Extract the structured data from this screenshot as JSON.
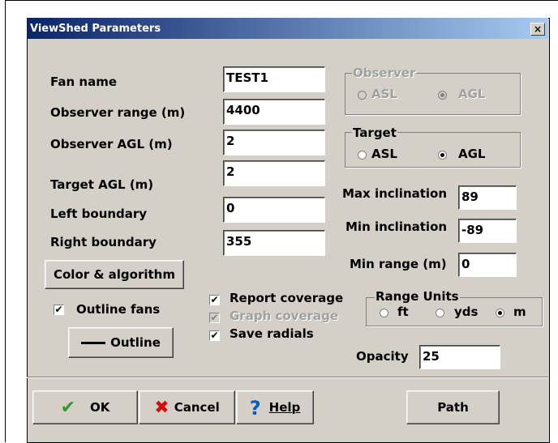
{
  "window": {
    "title": "ViewShed Parameters",
    "close": "×"
  },
  "fields": {
    "fan_name": {
      "label": "Fan name",
      "value": "TEST1"
    },
    "observer_range": {
      "label": "Observer range (m)",
      "value": "4400"
    },
    "observer_agl": {
      "label": "Observer AGL (m)",
      "value": "2"
    },
    "target_agl": {
      "label": "Target AGL (m)",
      "value": "2"
    },
    "left_boundary": {
      "label": "Left boundary",
      "value": "0"
    },
    "right_boundary": {
      "label": "Right boundary",
      "value": "355"
    },
    "max_inclination": {
      "label": "Max inclination",
      "value": "89"
    },
    "min_inclination": {
      "label": "Min inclination",
      "value": "-89"
    },
    "min_range": {
      "label": "Min range (m)",
      "value": "0"
    },
    "opacity": {
      "label": "Opacity",
      "value": "25"
    }
  },
  "observer_group": {
    "title": "Observer",
    "asl": "ASL",
    "agl": "AGL",
    "selected": "AGL",
    "enabled": false
  },
  "target_group": {
    "title": "Target",
    "asl": "ASL",
    "agl": "AGL",
    "selected": "AGL"
  },
  "range_units": {
    "title": "Range Units",
    "ft": "ft",
    "yds": "yds",
    "m": "m",
    "selected": "m"
  },
  "checkboxes": {
    "outline_fans": {
      "label": "Outline fans",
      "checked": true
    },
    "report_coverage": {
      "label": "Report coverage",
      "checked": true
    },
    "graph_coverage": {
      "label": "Graph coverage",
      "checked": true,
      "enabled": false
    },
    "save_radials": {
      "label": "Save radials",
      "checked": true
    }
  },
  "buttons": {
    "color_algorithm": "Color & algorithm",
    "outline": "Outline",
    "ok": "OK",
    "cancel": "Cancel",
    "help": "Help",
    "path": "Path"
  }
}
